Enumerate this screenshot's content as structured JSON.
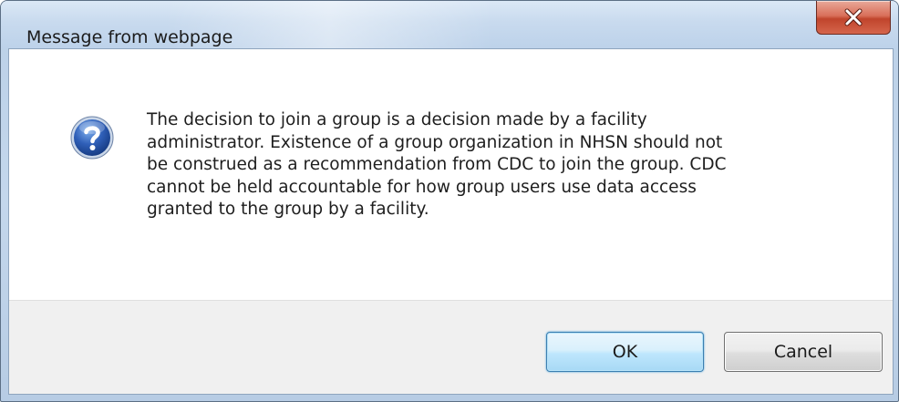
{
  "window": {
    "title": "Message from webpage"
  },
  "dialog": {
    "message_lines": [
      "The decision to join a group is a decision made by a facility",
      "administrator.  Existence of a group organization in NHSN should not",
      "be construed as a recommendation from CDC to join the group.  CDC",
      "cannot be held accountable for how group users use data access",
      "granted to the group by a facility."
    ],
    "icon": "question-icon"
  },
  "buttons": {
    "ok_label": "OK",
    "cancel_label": "Cancel",
    "close_icon": "close-icon"
  },
  "colors": {
    "title_bar": "#c8daee",
    "close_button": "#c0442c",
    "footer": "#f0f0f0",
    "ok_focus": "#3c7fb1",
    "icon_blue": "#2f5fb8"
  }
}
